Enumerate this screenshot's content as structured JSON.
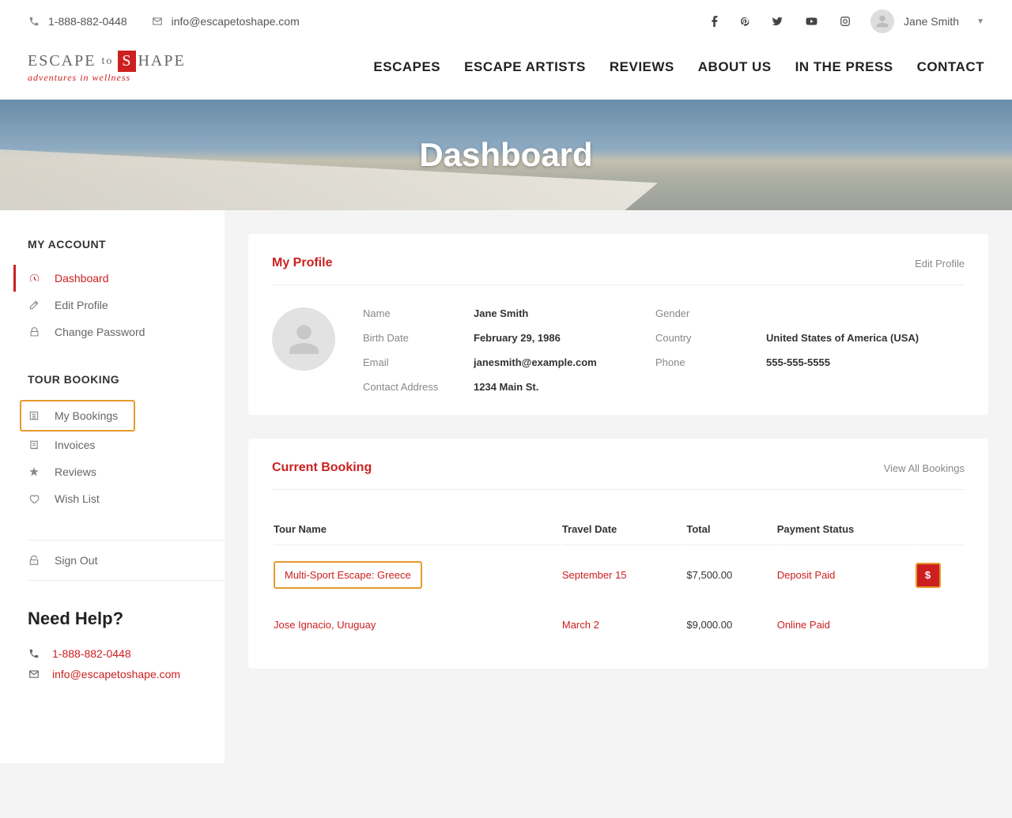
{
  "topbar": {
    "phone": "1-888-882-0448",
    "email": "info@escapetoshape.com",
    "user_name": "Jane Smith"
  },
  "logo": {
    "line1_a": "ESCAPE",
    "line1_b": "to",
    "line1_c": "S",
    "line1_d": "HAPE",
    "tagline": "adventures in wellness"
  },
  "nav": {
    "items": [
      "ESCAPES",
      "ESCAPE ARTISTS",
      "REVIEWS",
      "ABOUT US",
      "IN THE PRESS",
      "CONTACT"
    ]
  },
  "banner": {
    "title": "Dashboard"
  },
  "sidebar": {
    "my_account_heading": "MY ACCOUNT",
    "account_items": [
      {
        "label": "Dashboard"
      },
      {
        "label": "Edit Profile"
      },
      {
        "label": "Change Password"
      }
    ],
    "tour_booking_heading": "TOUR BOOKING",
    "booking_items": [
      {
        "label": "My Bookings"
      },
      {
        "label": "Invoices"
      },
      {
        "label": "Reviews"
      },
      {
        "label": "Wish List"
      }
    ],
    "sign_out": "Sign Out",
    "help": {
      "heading": "Need Help?",
      "phone": "1-888-882-0448",
      "email": "info@escapetoshape.com"
    }
  },
  "profile_card": {
    "title": "My Profile",
    "edit_link": "Edit Profile",
    "fields": {
      "name_label": "Name",
      "name_val": "Jane Smith",
      "gender_label": "Gender",
      "gender_val": "",
      "birth_label": "Birth Date",
      "birth_val": "February 29, 1986",
      "country_label": "Country",
      "country_val": "United States of America (USA)",
      "email_label": "Email",
      "email_val": "janesmith@example.com",
      "phone_label": "Phone",
      "phone_val": "555-555-5555",
      "addr_label": "Contact Address",
      "addr_val": "1234 Main St."
    }
  },
  "booking_card": {
    "title": "Current Booking",
    "view_all": "View All Bookings",
    "columns": {
      "tour": "Tour Name",
      "date": "Travel Date",
      "total": "Total",
      "status": "Payment Status"
    },
    "rows": [
      {
        "tour": "Multi-Sport Escape: Greece",
        "date": "September 15",
        "total": "$7,500.00",
        "status": "Deposit Paid",
        "pay_icon": "$"
      },
      {
        "tour": "Jose Ignacio, Uruguay",
        "date": "March 2",
        "total": "$9,000.00",
        "status": "Online Paid",
        "pay_icon": ""
      }
    ]
  }
}
